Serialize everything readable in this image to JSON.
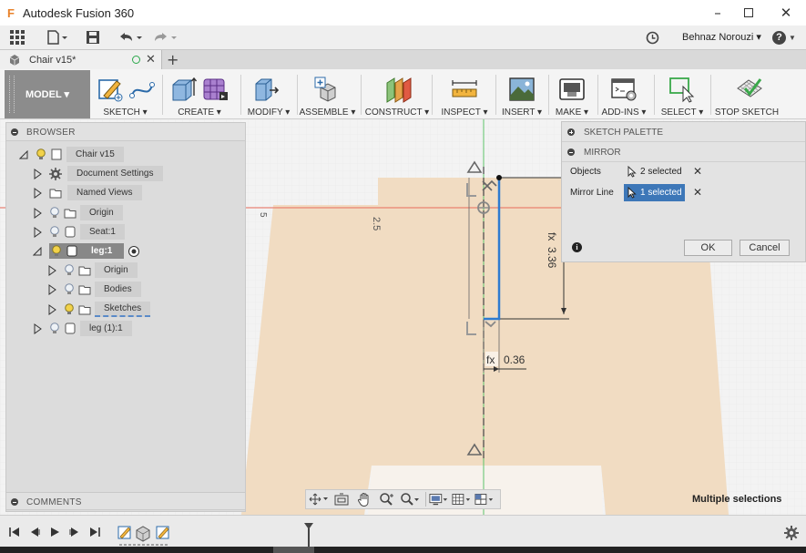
{
  "window": {
    "title": "Autodesk Fusion 360",
    "logo_letter": "F",
    "minimize_icon": "minimize-icon",
    "maximize_icon": "maximize-icon",
    "close_icon": "close-icon"
  },
  "quick_access": {
    "user_name": "Behnaz Norouzi ▾",
    "help_label": "?"
  },
  "document_tab": {
    "label": "Chair v15*",
    "add_tab": "+"
  },
  "toolbar": {
    "workspace_label": "MODEL ▾",
    "groups": {
      "sketch": "SKETCH ▾",
      "create": "CREATE ▾",
      "modify": "MODIFY ▾",
      "assemble": "ASSEMBLE ▾",
      "construct": "CONSTRUCT ▾",
      "inspect": "INSPECT ▾",
      "insert": "INSERT ▾",
      "make": "MAKE ▾",
      "addins": "ADD-INS ▾",
      "select": "SELECT ▾",
      "stop_sketch": "STOP SKETCH"
    }
  },
  "browser": {
    "title": "BROWSER",
    "items": {
      "root": "Chair v15",
      "doc_settings": "Document Settings",
      "named_views": "Named Views",
      "origin": "Origin",
      "seat": "Seat:1",
      "leg": "leg:1",
      "leg_origin": "Origin",
      "leg_bodies": "Bodies",
      "leg_sketches": "Sketches",
      "leg1": "leg (1):1"
    }
  },
  "comments": {
    "title": "COMMENTS"
  },
  "palette": {
    "sketch_palette_title": "SKETCH PALETTE",
    "mirror_title": "MIRROR",
    "objects_label": "Objects",
    "objects_value": "2 selected",
    "mirror_line_label": "Mirror Line",
    "mirror_line_value": "1 selected",
    "ok_label": "OK",
    "cancel_label": "Cancel",
    "info_icon": "i"
  },
  "canvas": {
    "dim_vertical": "3.36",
    "dim_horizontal": "0.36",
    "dim_prefix": "fx",
    "ruler_label_a": "5",
    "ruler_label_b": "2.5"
  },
  "status": {
    "text": "Multiple selections"
  },
  "colors": {
    "accent_blue": "#2e7bd0",
    "selected_blue": "#3d77b8",
    "shape_fill": "#f1dcc2",
    "axis_red": "#e86a5a",
    "axis_green": "#5cc36a"
  }
}
